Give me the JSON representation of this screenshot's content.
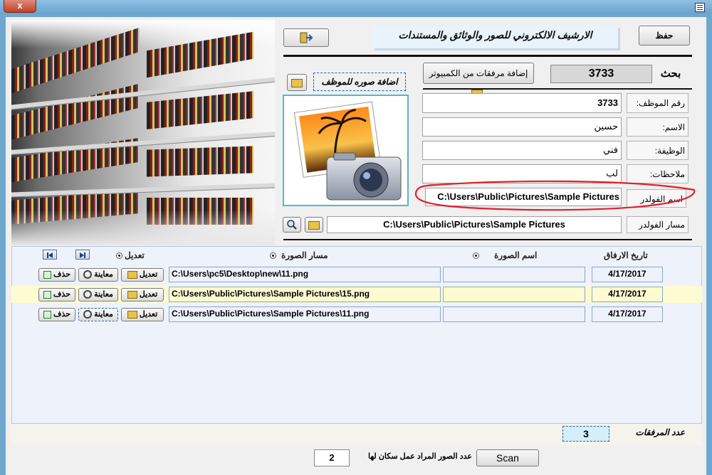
{
  "window": {
    "close_label": "x"
  },
  "header": {
    "save_label": "حفظ",
    "app_title": "الارشيف  الالكتروني للصور  والوثائق والمستندات",
    "exit_icon": "exit-door-icon"
  },
  "search": {
    "label": "بحث",
    "value": "3733"
  },
  "actions": {
    "add_attachment_label": "إضافة مرفقات من الكمبيوتر",
    "add_employee_photo_label": "اضافة صوره للموظف"
  },
  "employee": {
    "number_label": "رقم الموظف:",
    "number_value": "3733",
    "name_label": "الاسم:",
    "name_value": "حسين",
    "job_label": "الوظيفة:",
    "job_value": "فني",
    "notes_label": "ملاحظات:",
    "notes_value": "لب",
    "folder_name_label": "اسم الفولدر",
    "folder_name_value": "C:\\Users\\Public\\Pictures\\Sample Pictures",
    "folder_path_label": "مسار الفولدر",
    "folder_path_value": "C:\\Users\\Public\\Pictures\\Sample Pictures"
  },
  "list": {
    "edit_label": "تعديل",
    "col_image_path": "مسار الصورة",
    "col_image_name": "اسم الصورة",
    "col_attach_date": "تاريخ الارفاق",
    "rows": [
      {
        "path": "C:\\Users\\pc5\\Desktop\\new\\11.png",
        "name": "",
        "date": "4/17/2017",
        "delete": "حذف",
        "preview": "معاينة",
        "edit": "تعديل"
      },
      {
        "path": "C:\\Users\\Public\\Pictures\\Sample Pictures\\15.png",
        "name": "",
        "date": "4/17/2017",
        "delete": "حذف",
        "preview": "معاينة",
        "edit": "تعديل"
      },
      {
        "path": "C:\\Users\\Public\\Pictures\\Sample Pictures\\11.png",
        "name": "",
        "date": "4/17/2017",
        "delete": "حذف",
        "preview": "معاينة",
        "edit": "تعديل"
      }
    ]
  },
  "summary": {
    "attachments_count_label": "عدد المرفقات",
    "attachments_count": "3"
  },
  "scan": {
    "count_label": "عدد الصور المراد عمل سكان لها",
    "count_value": "2",
    "button_label": "Scan"
  },
  "colors": {
    "annotation_circle": "#e0202a",
    "selected_row": "#fdfbd1"
  }
}
